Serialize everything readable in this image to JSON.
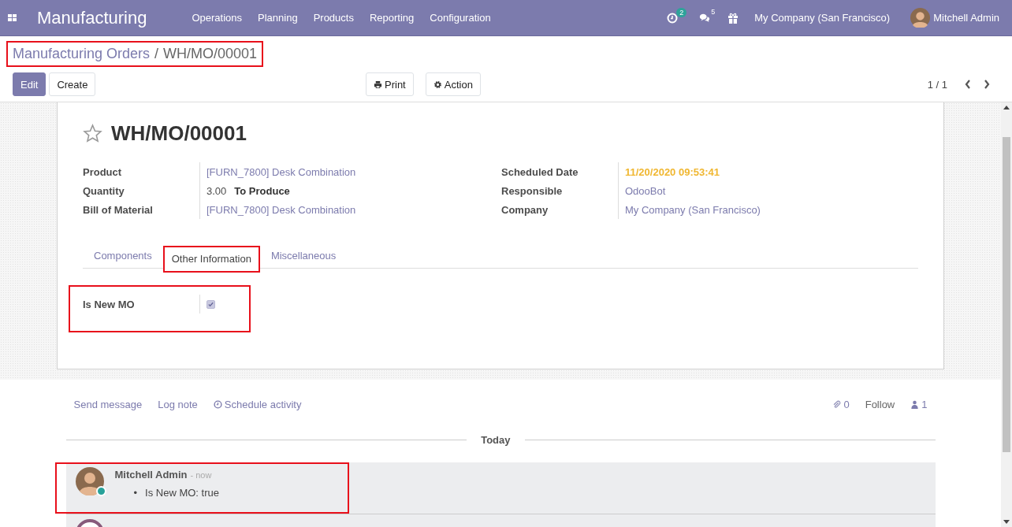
{
  "navbar": {
    "app_title": "Manufacturing",
    "menu": [
      "Operations",
      "Planning",
      "Products",
      "Reporting",
      "Configuration"
    ],
    "activity_count": "2",
    "message_count": "5",
    "company": "My Company (San Francisco)",
    "user": "Mitchell Admin"
  },
  "breadcrumb": [
    {
      "label": "Manufacturing Orders",
      "kind": "link"
    },
    {
      "label": "WH/MO/00001",
      "kind": "current"
    }
  ],
  "breadcrumb_separator": "/",
  "buttons": [
    {
      "label": "Edit",
      "kind": "primary"
    },
    {
      "label": "Create",
      "kind": "secondary"
    }
  ],
  "center_buttons": [
    {
      "label": "Print",
      "kind": "print"
    },
    {
      "label": "Action",
      "kind": "gear"
    }
  ],
  "pager": "1 / 1",
  "record": {
    "starred": false,
    "title": "WH/MO/00001",
    "left_fields": [
      {
        "label": "Product",
        "value": "[FURN_7800] Desk Combination",
        "kind": "link"
      },
      {
        "label": "Quantity",
        "value": "3.00",
        "suffix": "To Produce",
        "kind": "plain"
      },
      {
        "label": "Bill of Material",
        "value": "[FURN_7800] Desk Combination",
        "kind": "link"
      }
    ],
    "right_fields": [
      {
        "label": "Scheduled Date",
        "value": "11/20/2020 09:53:41",
        "kind": "warning"
      },
      {
        "label": "Responsible",
        "value": "OdooBot",
        "kind": "link"
      },
      {
        "label": "Company",
        "value": "My Company (San Francisco)",
        "kind": "link"
      }
    ]
  },
  "tabs": [
    {
      "label": "Components",
      "selected": false
    },
    {
      "label": "Other Information",
      "selected": true
    },
    {
      "label": "Miscellaneous",
      "selected": false
    }
  ],
  "tab_fields": [
    {
      "label": "Is New MO",
      "checked": true
    }
  ],
  "chatter": {
    "actions": [
      {
        "label": "Send message",
        "kind": "plain"
      },
      {
        "label": "Log note",
        "kind": "plain"
      },
      {
        "label": "Schedule activity",
        "kind": "clock"
      }
    ],
    "attachments": "0",
    "follow": "Follow",
    "followers": "1",
    "date_separator": "Today",
    "messages": [
      {
        "author": "Mitchell Admin",
        "time": "- now",
        "bullet": "•",
        "changes": [
          "Is New MO: true"
        ],
        "online": true,
        "kind": "user"
      },
      {
        "kind": "bot"
      }
    ]
  }
}
